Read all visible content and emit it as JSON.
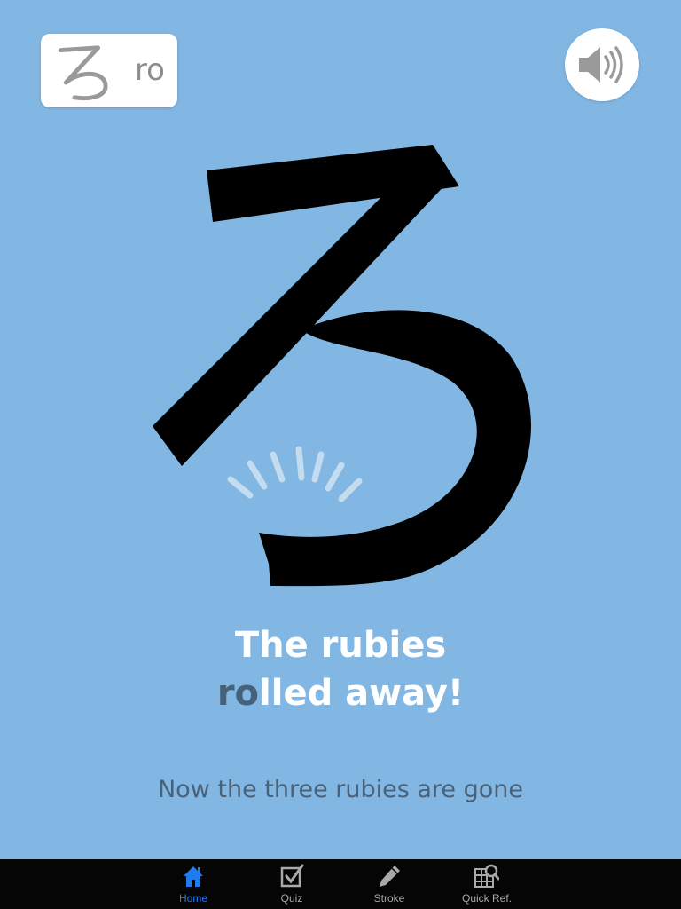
{
  "card": {
    "kana": "ろ",
    "romaji": "ro"
  },
  "sound": {
    "icon": "speaker-icon"
  },
  "character": {
    "kana": "ろ",
    "color": "#000000"
  },
  "mnemonic": {
    "line1": "The rubies",
    "line2_highlight": "ro",
    "line2_rest": "lled away!",
    "highlight_color": "#45627a"
  },
  "caption": "Now the three rubies are gone",
  "tabs": [
    {
      "label": "Home",
      "icon": "home-icon",
      "active": true
    },
    {
      "label": "Quiz",
      "icon": "checkbox-icon",
      "active": false
    },
    {
      "label": "Stroke",
      "icon": "pencil-icon",
      "active": false
    },
    {
      "label": "Quick Ref.",
      "icon": "grid-search-icon",
      "active": false
    }
  ],
  "colors": {
    "background": "#82b7e4",
    "tab_bar": "#050505",
    "tab_active": "#1f7bf0",
    "tab_inactive": "#a9a9a9"
  }
}
